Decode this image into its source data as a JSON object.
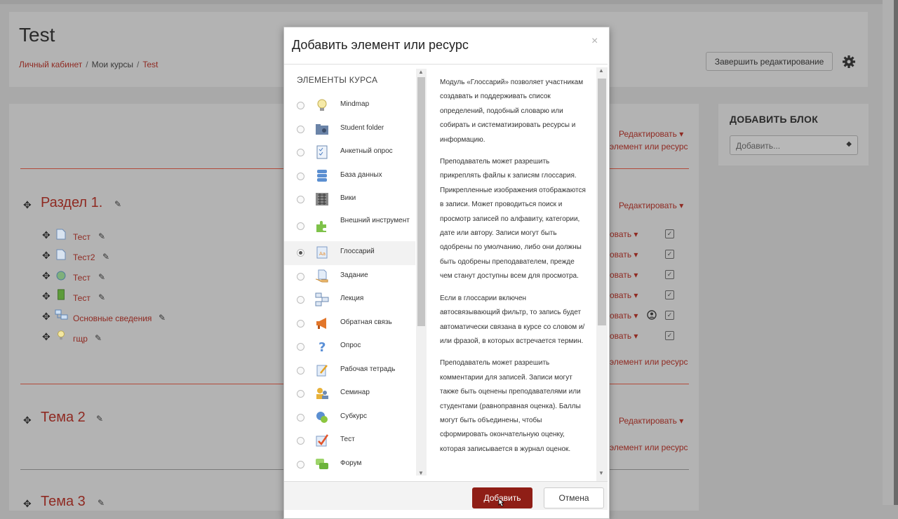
{
  "page": {
    "title": "Test",
    "breadcrumb": [
      "Личный кабинет",
      "Мои курсы",
      "Test"
    ],
    "finish_editing": "Завершить редактирование"
  },
  "sidebar_block": {
    "title": "ДОБАВИТЬ БЛОК",
    "select_value": "Добавить..."
  },
  "course": {
    "edit_label": "Редактировать ▾",
    "add_activity": "элемент или ресурс",
    "edit_partial": "овать ▾",
    "sections": [
      {
        "title": "Раздел 1."
      },
      {
        "title": "Тема 2"
      },
      {
        "title": "Тема 3"
      }
    ],
    "modules": [
      {
        "name": "Тест",
        "icon": "page-icon"
      },
      {
        "name": "Тест2",
        "icon": "page-icon"
      },
      {
        "name": "Тест",
        "icon": "globe-icon"
      },
      {
        "name": "Тест",
        "icon": "book-icon"
      },
      {
        "name": "Основные сведения",
        "icon": "folder-icon"
      },
      {
        "name": "гщр",
        "icon": "lightbulb-icon"
      }
    ]
  },
  "modal": {
    "title": "Добавить элемент или ресурс",
    "close": "×",
    "list_heading": "ЭЛЕМЕНТЫ КУРСА",
    "items": [
      {
        "label": "Mindmap",
        "icon": "lightbulb-icon",
        "selected": false
      },
      {
        "label": "Student folder",
        "icon": "student-folder-icon",
        "selected": false
      },
      {
        "label": "Анкетный опрос",
        "icon": "survey-icon",
        "selected": false
      },
      {
        "label": "База данных",
        "icon": "database-icon",
        "selected": false
      },
      {
        "label": "Вики",
        "icon": "wiki-icon",
        "selected": false
      },
      {
        "label": "Внешний инструмент",
        "icon": "puzzle-icon",
        "selected": false
      },
      {
        "label": "Глоссарий",
        "icon": "glossary-icon",
        "selected": true
      },
      {
        "label": "Задание",
        "icon": "assignment-icon",
        "selected": false
      },
      {
        "label": "Лекция",
        "icon": "lesson-icon",
        "selected": false
      },
      {
        "label": "Обратная связь",
        "icon": "megaphone-icon",
        "selected": false
      },
      {
        "label": "Опрос",
        "icon": "question-icon",
        "selected": false
      },
      {
        "label": "Рабочая тетрадь",
        "icon": "workbook-icon",
        "selected": false
      },
      {
        "label": "Семинар",
        "icon": "seminar-icon",
        "selected": false
      },
      {
        "label": "Субкурс",
        "icon": "subcourse-icon",
        "selected": false
      },
      {
        "label": "Тест",
        "icon": "quiz-icon",
        "selected": false
      },
      {
        "label": "Форум",
        "icon": "forum-icon",
        "selected": false
      }
    ],
    "description": [
      "Модуль «Глоссарий» позволяет участникам создавать и поддерживать список определений, подобный словарю или собирать и систематизировать ресурсы и информацию.",
      "Преподаватель может разрешить прикреплять файлы к записям глоссария. Прикрепленные изображения отображаются в записи. Может проводиться поиск и просмотр записей по алфавиту, категории, дате или автору. Записи могут быть одобрены по умолчанию, либо они должны быть одобрены преподавателем, прежде чем станут доступны всем для просмотра.",
      "Если в глоссарии включен автосвязывающий фильтр, то запись будет автоматически связана в курсе со словом и/или фразой, в которых встречается термин.",
      "Преподаватель может разрешить комментарии для записей. Записи могут также быть оценены преподавателями или студентами (равноправная оценка). Баллы могут быть объединены, чтобы сформировать окончательную оценку, которая записывается в журнал оценок."
    ],
    "add_button": "Добавить",
    "cancel_button": "Отмена"
  }
}
